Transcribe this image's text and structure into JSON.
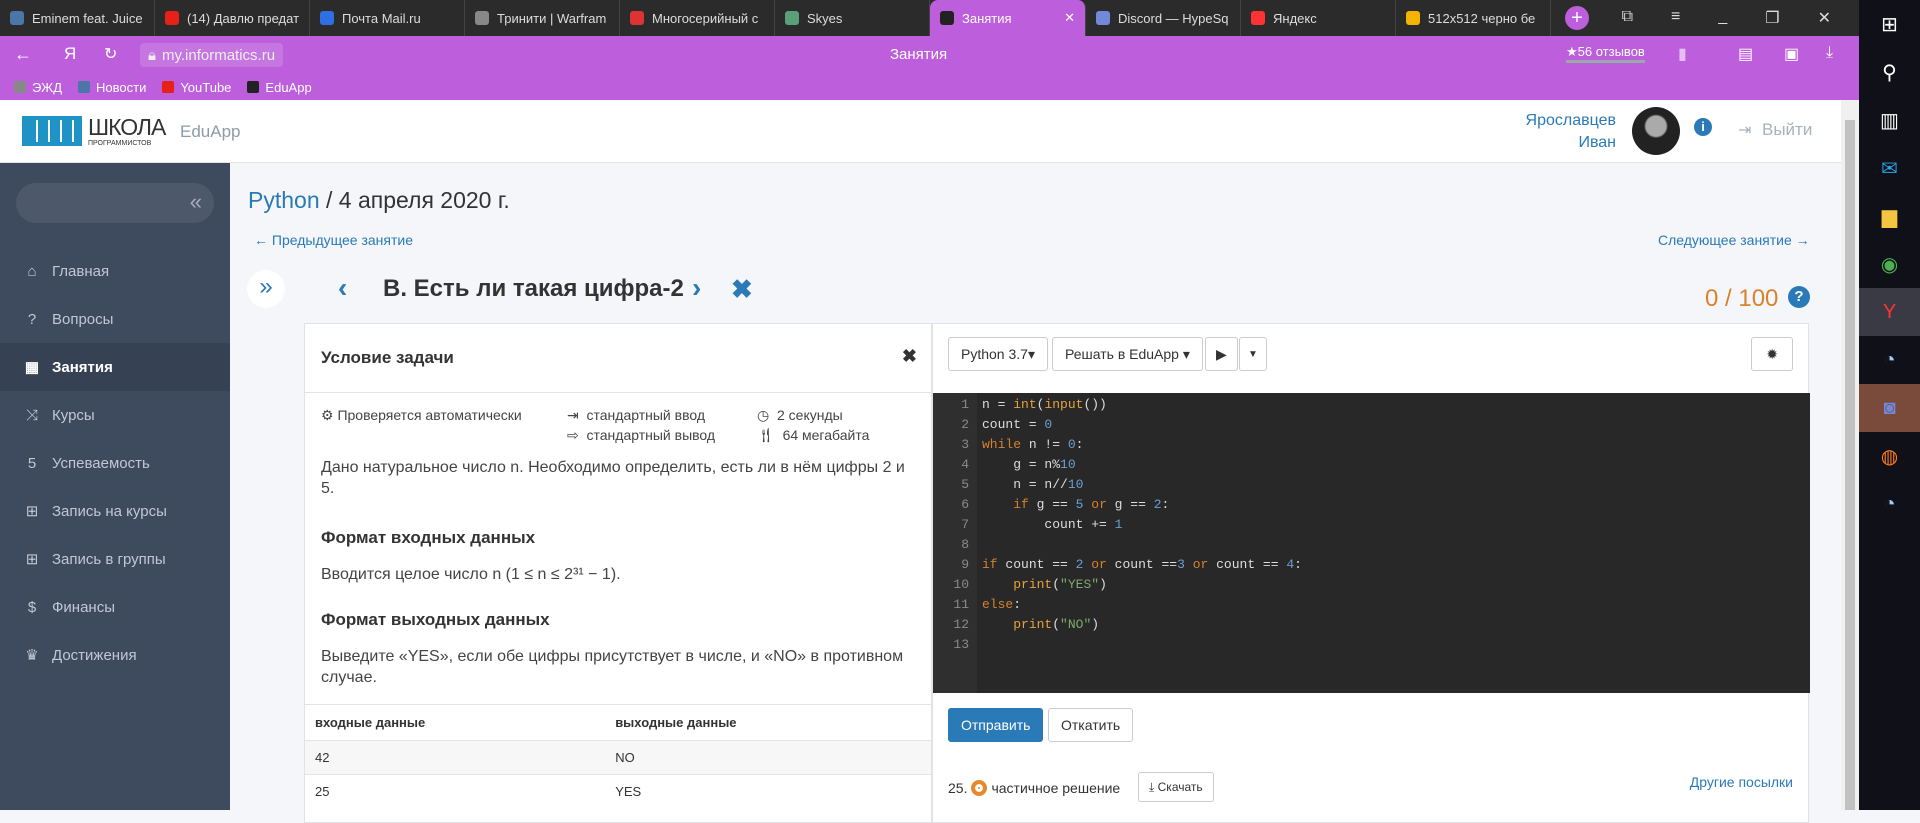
{
  "browser": {
    "tabs": [
      {
        "label": "Eminem feat. Juice",
        "color": "#4a76a8"
      },
      {
        "label": "(14) Давлю предат",
        "color": "#e62117"
      },
      {
        "label": "Почта Mail.ru",
        "color": "#2f6fe6"
      },
      {
        "label": "Тринити | Warfram",
        "color": "#888888"
      },
      {
        "label": "Многосерийный с",
        "color": "#d33"
      },
      {
        "label": "Skyes",
        "color": "#5a9e7a"
      },
      {
        "label": "Занятия",
        "color": "#222222",
        "active": true
      },
      {
        "label": "Discord — HypeSq",
        "color": "#7289da"
      },
      {
        "label": "Яндекс",
        "color": "#f33"
      },
      {
        "label": "512x512 черно бе",
        "color": "#f5b400"
      }
    ],
    "url": "my.informatics.ru",
    "page_title": "Занятия",
    "reviews": "★56 отзывов",
    "bookmarks": [
      "ЭЖД",
      "Новости",
      "YouTube",
      "EduApp"
    ],
    "accent": "#bd5fdc"
  },
  "site": {
    "logo_main": "ШКОЛА",
    "logo_sub": "ПРОГРАММИСТОВ",
    "app": "EduApp",
    "user_last": "Ярославцев",
    "user_first": "Иван",
    "logout": "Выйти"
  },
  "sidebar": {
    "items": [
      {
        "icon": "home-icon",
        "glyph": "⌂",
        "label": "Главная"
      },
      {
        "icon": "question-icon",
        "glyph": "?",
        "label": "Вопросы"
      },
      {
        "icon": "calendar-icon",
        "glyph": "▦",
        "label": "Занятия",
        "active": true
      },
      {
        "icon": "shuffle-icon",
        "glyph": "⤨",
        "label": "Курсы"
      },
      {
        "icon": "grade-icon",
        "glyph": "5",
        "label": "Успеваемость"
      },
      {
        "icon": "plus-square-icon",
        "glyph": "⊞",
        "label": "Запись на курсы"
      },
      {
        "icon": "plus-square-icon",
        "glyph": "⊞",
        "label": "Запись в группы"
      },
      {
        "icon": "dollar-icon",
        "glyph": "$",
        "label": "Финансы"
      },
      {
        "icon": "trophy-icon",
        "glyph": "♛",
        "label": "Достижения"
      }
    ]
  },
  "main": {
    "course": "Python",
    "date": " / 4 апреля 2020 г.",
    "prev": "← Предыдущее занятие",
    "next": "Следующее занятие →",
    "problem_title": "B. Есть ли такая цифра-2",
    "score": "0 / 100"
  },
  "problem": {
    "header": "Условие задачи",
    "check": "Проверяется автоматически",
    "input": "стандартный ввод",
    "output": "стандартный вывод",
    "time": "2 секунды",
    "memory": "64 мегабайта",
    "statement": "Дано натуральное число n. Необходимо определить, есть ли в нём цифры 2 и 5.",
    "input_format_title": "Формат входных данных",
    "input_format": "Вводится целое число n (1 ≤ n ≤ 2³¹ − 1).",
    "output_format_title": "Формат выходных данных",
    "output_format": "Выведите «YES», если обе цифры присутствует в числе, и «NO» в противном случае.",
    "examples_headers": [
      "входные данные",
      "выходные данные"
    ],
    "examples": [
      [
        "42",
        "NO"
      ],
      [
        "25",
        "YES"
      ]
    ]
  },
  "editor": {
    "language": "Python 3.7",
    "solve": "Решать в EduApp",
    "submit": "Отправить",
    "rollback": "Откатить",
    "line_numbers": [
      "1",
      "2",
      "3",
      "4",
      "5",
      "6",
      "7",
      "8",
      "9",
      "10",
      "11",
      "12",
      "13"
    ],
    "attempt_no": "25.",
    "attempt_status": "частичное решение",
    "download": "Скачать",
    "other": "Другие посылки"
  }
}
